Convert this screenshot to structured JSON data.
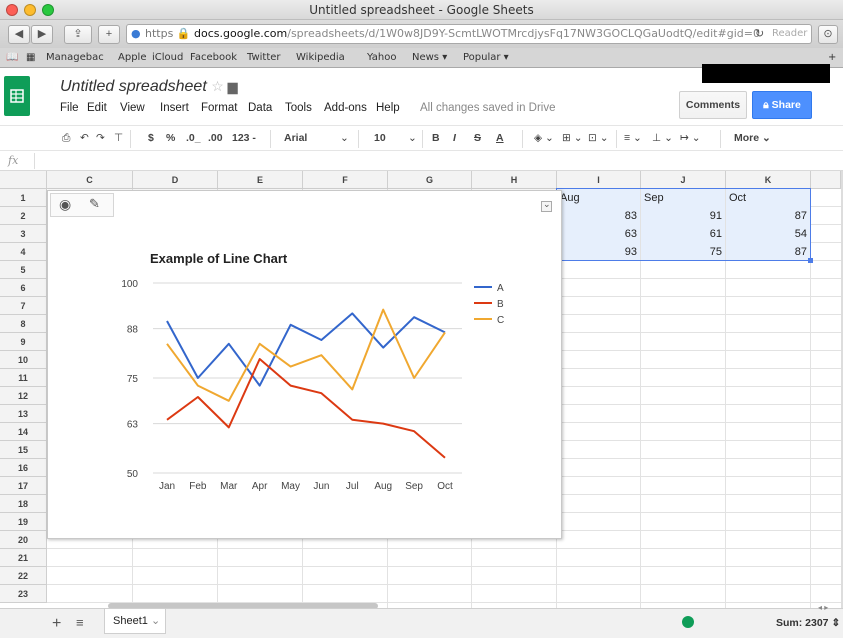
{
  "window": {
    "title": "Untitled spreadsheet - Google Sheets"
  },
  "browser": {
    "url_scheme": "https",
    "url_host": "docs.google.com",
    "url_path": "/spreadsheets/d/1W0w8JD9Y-ScmtLWOTMrcdjysFq17NW3GOCLQGaUodtQ/edit#gid=0",
    "reader_label": "Reader",
    "bookmarks": [
      "Managebac",
      "Apple",
      "iCloud",
      "Facebook",
      "Twitter",
      "Wikipedia",
      "Yahoo",
      "News ▾",
      "Popular ▾"
    ]
  },
  "doc": {
    "title": "Untitled spreadsheet",
    "menu": [
      "File",
      "Edit",
      "View",
      "Insert",
      "Format",
      "Data",
      "Tools",
      "Add-ons",
      "Help"
    ],
    "save_status": "All changes saved in Drive",
    "comments_label": "Comments",
    "share_label": "Share"
  },
  "format_toolbar": {
    "currency": "$",
    "percent": "%",
    "dec_less": ".0_",
    "dec_more": ".00",
    "number_format": "123 -",
    "font": "Arial",
    "font_size": "10",
    "bold": "B",
    "italic": "I",
    "strike": "S",
    "text_color": "A",
    "more": "More"
  },
  "formula_bar": {
    "fx": "fx",
    "value": ""
  },
  "grid": {
    "columns": [
      "C",
      "D",
      "E",
      "F",
      "G",
      "H",
      "I",
      "J",
      "K"
    ],
    "rows": [
      "1",
      "2",
      "3",
      "4",
      "5",
      "6",
      "7",
      "8",
      "9",
      "10",
      "11",
      "12",
      "13",
      "14",
      "15",
      "16",
      "17",
      "18",
      "19",
      "20",
      "21",
      "22",
      "23"
    ],
    "visible_cells": {
      "I1": "Aug",
      "J1": "Sep",
      "K1": "Oct",
      "I2": "83",
      "J2": "91",
      "K2": "87",
      "I3": "63",
      "J3": "61",
      "K3": "54",
      "I4": "93",
      "J4": "75",
      "K4": "87"
    }
  },
  "chart_data": {
    "type": "line",
    "title": "Example of Line Chart",
    "categories": [
      "Jan",
      "Feb",
      "Mar",
      "Apr",
      "May",
      "Jun",
      "Jul",
      "Aug",
      "Sep",
      "Oct"
    ],
    "yticks": [
      "100",
      "88",
      "75",
      "63",
      "50"
    ],
    "ylim": [
      50,
      100
    ],
    "legend_position": "right",
    "grid": true,
    "series": [
      {
        "name": "A",
        "color": "#3366cc",
        "values": [
          90,
          75,
          84,
          73,
          89,
          85,
          92,
          83,
          91,
          87
        ]
      },
      {
        "name": "B",
        "color": "#dc3912",
        "values": [
          64,
          70,
          62,
          80,
          73,
          71,
          64,
          63,
          61,
          54
        ]
      },
      {
        "name": "C",
        "color": "#f0a830",
        "values": [
          84,
          73,
          69,
          84,
          78,
          81,
          72,
          93,
          75,
          87
        ]
      }
    ]
  },
  "bottom": {
    "sheet_tab": "Sheet1",
    "sum_label": "Sum: 2307"
  },
  "colors": {
    "sheets_green": "#0f9d58",
    "share_blue": "#4d90fe",
    "selection": "#4d7ce8"
  }
}
